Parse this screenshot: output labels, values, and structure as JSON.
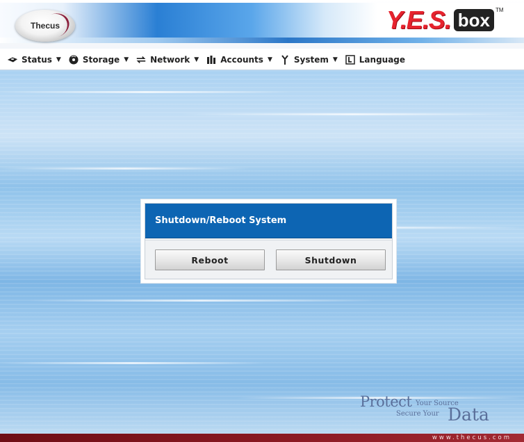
{
  "header": {
    "brand_left": "Thecus",
    "brand_right": "Y.E.S.",
    "brand_box": "box",
    "trademark": "TM"
  },
  "menu": {
    "items": [
      {
        "label": "Status",
        "icon": "hard-drive-icon",
        "has_dropdown": true
      },
      {
        "label": "Storage",
        "icon": "disc-icon",
        "has_dropdown": true
      },
      {
        "label": "Network",
        "icon": "network-arrows-icon",
        "has_dropdown": true
      },
      {
        "label": "Accounts",
        "icon": "users-icon",
        "has_dropdown": true
      },
      {
        "label": "System",
        "icon": "wrench-icon",
        "has_dropdown": true
      },
      {
        "label": "Language",
        "icon": "language-icon",
        "has_dropdown": false
      }
    ],
    "dropdown_glyph": "▼"
  },
  "dialog": {
    "title": "Shutdown/Reboot System",
    "reboot_label": "Reboot",
    "shutdown_label": "Shutdown"
  },
  "tagline": {
    "protect": "Protect",
    "your_source": "Your Source",
    "secure_your": "Secure Your",
    "data": "Data"
  },
  "footer": {
    "url": "www.thecus.com"
  },
  "colors": {
    "dialog_title_bg": "#0d65b3",
    "brand_red": "#e6232e",
    "footer_bg": "#8d1b24",
    "tagline": "#5a6f9a"
  }
}
